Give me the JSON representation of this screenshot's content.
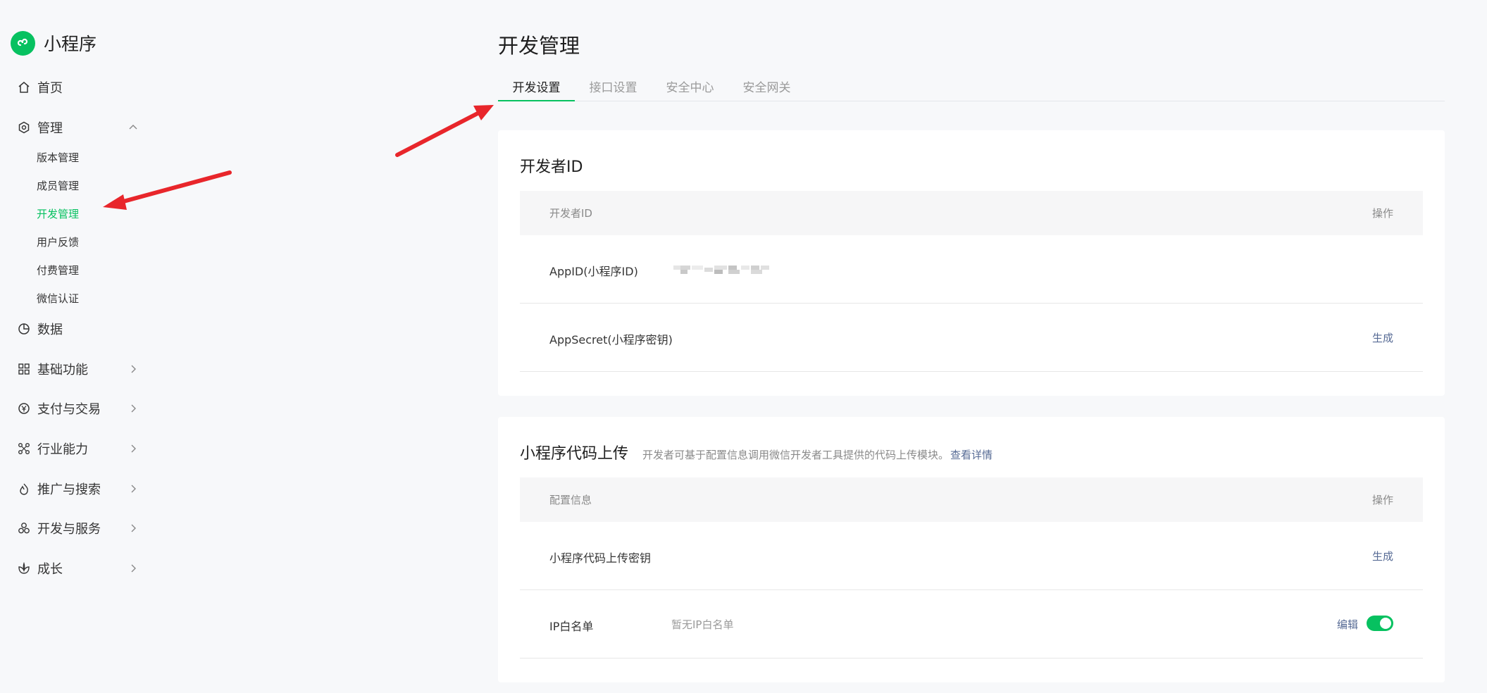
{
  "brand": {
    "title": "小程序"
  },
  "nav": {
    "home": "首页",
    "manage": "管理",
    "manage_sub": [
      "版本管理",
      "成员管理",
      "开发管理",
      "用户反馈",
      "付费管理",
      "微信认证"
    ],
    "data": "数据",
    "basic": "基础功能",
    "pay": "支付与交易",
    "industry": "行业能力",
    "promo": "推广与搜索",
    "devsvc": "开发与服务",
    "growth": "成长"
  },
  "main": {
    "title": "开发管理",
    "tabs": [
      "开发设置",
      "接口设置",
      "安全中心",
      "安全网关"
    ],
    "active_tab": "开发设置"
  },
  "dev_id_card": {
    "title": "开发者ID",
    "header": {
      "col1": "开发者ID",
      "col2": "操作"
    },
    "rows": [
      {
        "key": "AppID(小程序ID)",
        "value_masked": true
      },
      {
        "key": "AppSecret(小程序密钥)",
        "action": "生成"
      }
    ]
  },
  "upload_card": {
    "title": "小程序代码上传",
    "desc": "开发者可基于配置信息调用微信开发者工具提供的代码上传模块。",
    "desc_link": "查看详情",
    "header": {
      "col1": "配置信息",
      "col2": "操作"
    },
    "rows": [
      {
        "key": "小程序代码上传密钥",
        "action": "生成"
      },
      {
        "key": "IP白名单",
        "value": "暂无IP白名单",
        "action": "编辑",
        "toggle_on": true
      }
    ]
  },
  "colors": {
    "accent": "#07c160",
    "link": "#576b95",
    "annotation": "#e8262b"
  }
}
